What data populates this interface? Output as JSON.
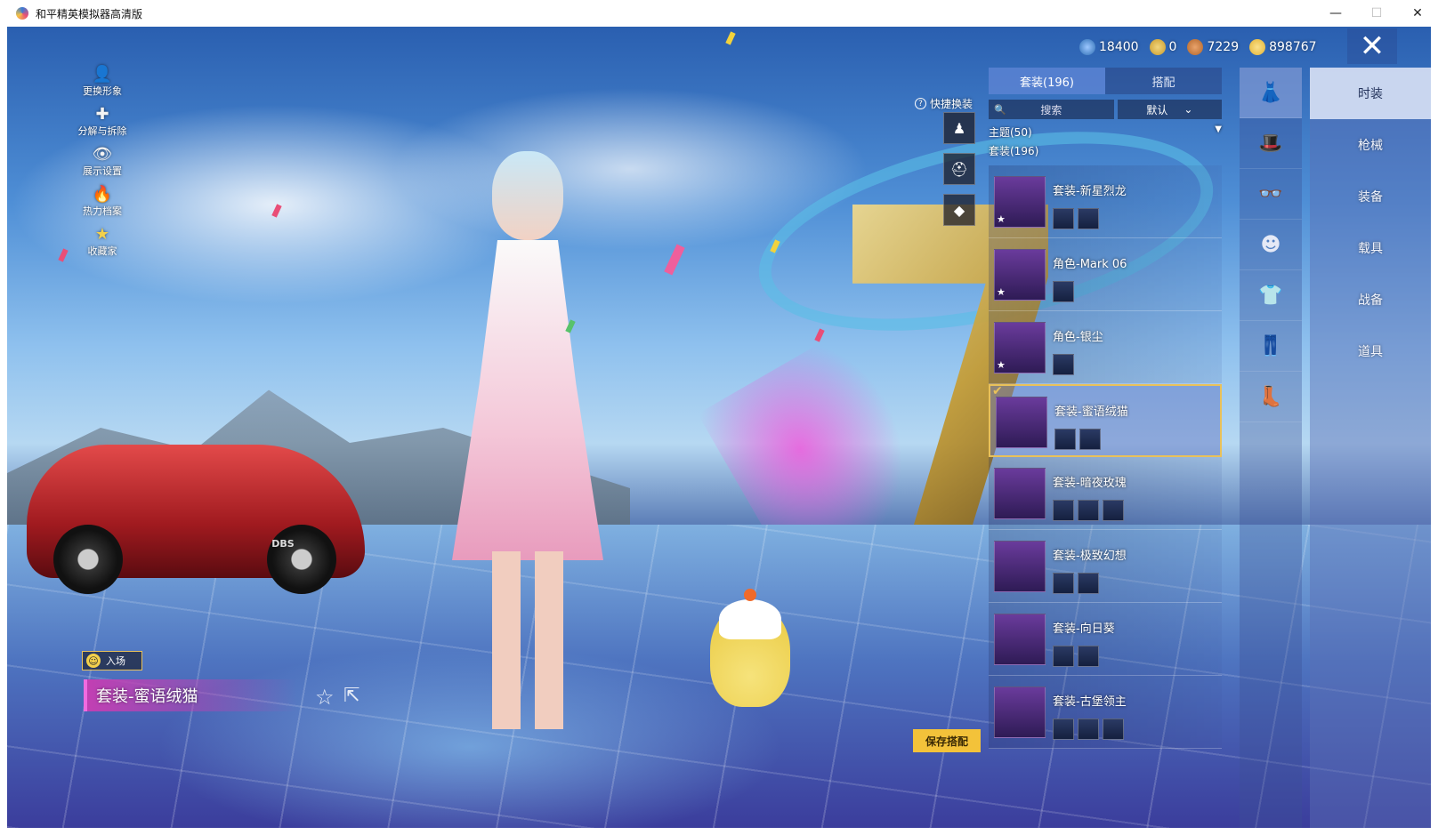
{
  "window": {
    "title": "和平精英模拟器高清版",
    "minimize": "—",
    "maximize": "☐",
    "close": "✕"
  },
  "left_tools": [
    {
      "name": "change-appearance",
      "label": "更换形象",
      "icon": "👤"
    },
    {
      "name": "disassemble",
      "label": "分解与拆除",
      "icon": "✚"
    },
    {
      "name": "display-settings",
      "label": "展示设置",
      "icon": "👁"
    },
    {
      "name": "heat-archive",
      "label": "热力档案",
      "icon": "🔥"
    },
    {
      "name": "collector",
      "label": "收藏家",
      "icon": "★"
    }
  ],
  "currency": [
    {
      "icon": "globe-coin-icon",
      "value": "18400",
      "color": "#2d6db3"
    },
    {
      "icon": "gold-c-coin-icon",
      "value": "0",
      "color": "#c99a2a"
    },
    {
      "icon": "bronze-coin-icon",
      "value": "7229",
      "color": "#b0642a"
    },
    {
      "icon": "gold-coin-icon",
      "value": "898767",
      "color": "#e3b334"
    }
  ],
  "quick_change": {
    "label": "快捷换装",
    "help": "?"
  },
  "panel": {
    "tabs": [
      {
        "label": "套装(196)",
        "active": true
      },
      {
        "label": "搭配",
        "active": false
      }
    ],
    "search_placeholder": "搜索",
    "sort_label": "默认",
    "filter_label": "主题(50)",
    "count_label": "套装(196)",
    "items": [
      {
        "name": "套装-新星烈龙",
        "parts": 2,
        "selected": false
      },
      {
        "name": "角色-Mark 06",
        "parts": 1,
        "selected": false
      },
      {
        "name": "角色-银尘",
        "parts": 1,
        "selected": false
      },
      {
        "name": "套装-蜜语绒猫",
        "parts": 2,
        "selected": true
      },
      {
        "name": "套装-暗夜玫瑰",
        "parts": 3,
        "selected": false
      },
      {
        "name": "套装-极致幻想",
        "parts": 2,
        "selected": false
      },
      {
        "name": "套装-向日葵",
        "parts": 2,
        "selected": false
      },
      {
        "name": "套装-古堡领主",
        "parts": 3,
        "selected": false
      }
    ]
  },
  "categories": [
    {
      "label": "时装",
      "icon": "outfit-icon",
      "active": true
    },
    {
      "label": "枪械",
      "icon": "hat-icon",
      "active": false
    },
    {
      "label": "装备",
      "icon": "glasses-icon",
      "active": false
    },
    {
      "label": "载具",
      "icon": "mask-icon",
      "active": false
    },
    {
      "label": "战备",
      "icon": "shirt-icon",
      "active": false
    },
    {
      "label": "道具",
      "icon": "pants-icon",
      "active": false
    }
  ],
  "extra_category_icon": "shoes-icon",
  "bottom": {
    "enter_label": "入场",
    "current_suit": "套装-蜜语绒猫",
    "save_button": "保存搭配"
  },
  "car_badge": "DBS"
}
